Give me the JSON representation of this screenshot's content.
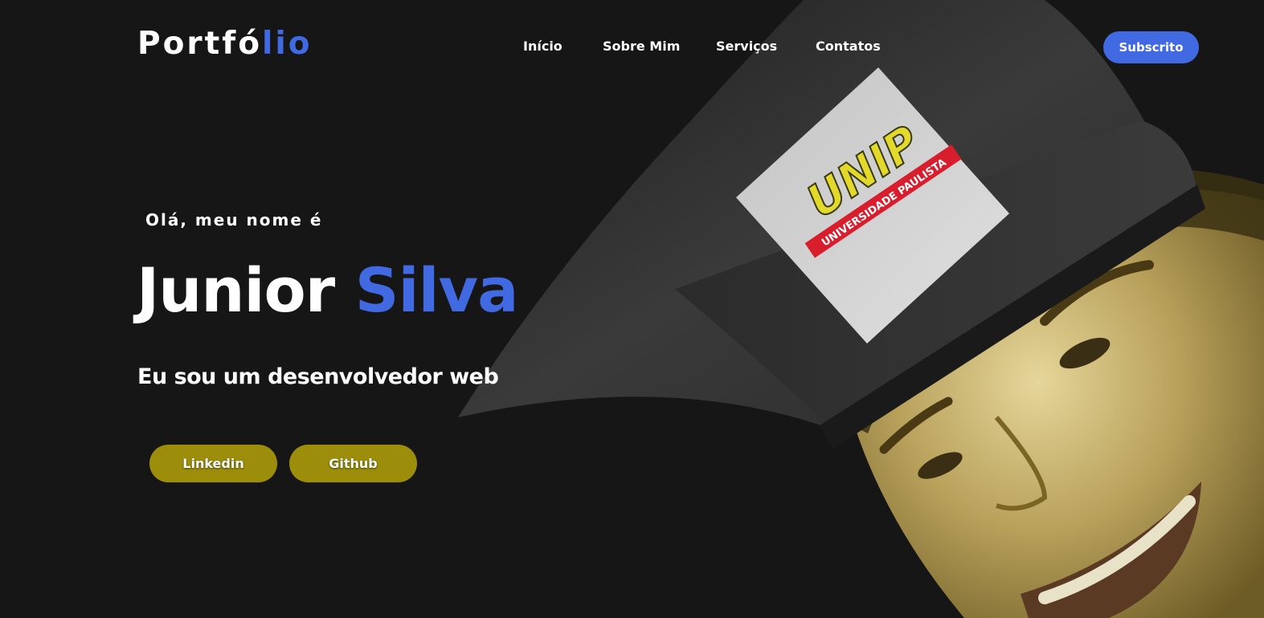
{
  "header": {
    "logo_main": "Portfó",
    "logo_accent": "lio",
    "nav": [
      {
        "label": "Início"
      },
      {
        "label": "Sobre Mim"
      },
      {
        "label": "Serviços"
      },
      {
        "label": "Contatos"
      }
    ],
    "subscribe_label": "Subscrito"
  },
  "hero": {
    "greeting": "Olá, meu nome é",
    "first_name": "Junior",
    "last_name": "Silva",
    "role": "Eu sou um desenvolvedor web",
    "buttons": [
      {
        "label": "Linkedin"
      },
      {
        "label": "Github"
      }
    ],
    "cap_badge_logo": "UNIP",
    "cap_badge_subtitle": "UNIVERSIDADE PAULISTA"
  },
  "colors": {
    "background": "#161616",
    "accent": "#4169e1",
    "button": "#9c8d0b"
  }
}
